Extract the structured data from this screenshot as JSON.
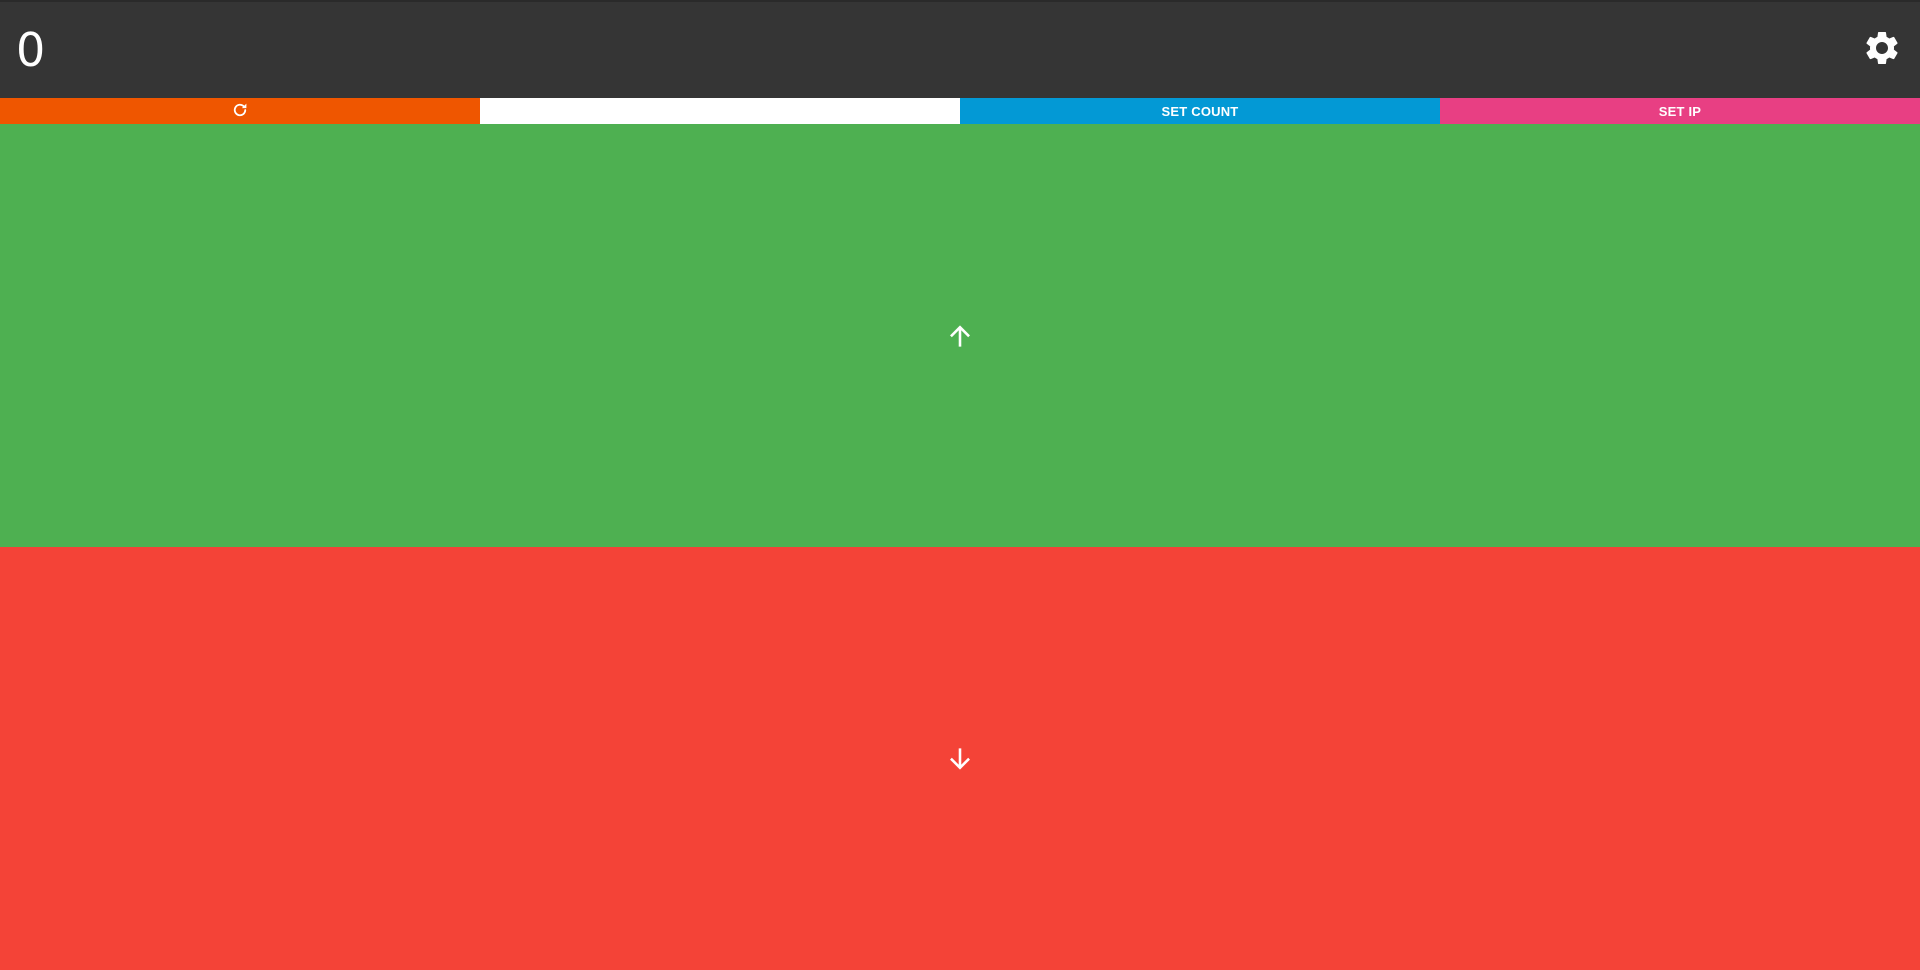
{
  "header": {
    "count_value": "0",
    "settings_icon": "gear-icon"
  },
  "toolbar": {
    "reset_icon": "refresh-icon",
    "count_input_value": "",
    "count_input_placeholder": "",
    "set_count_label": "SET COUNT",
    "set_ip_label": "SET IP"
  },
  "pads": {
    "up_icon": "arrow-up-icon",
    "down_icon": "arrow-down-icon"
  },
  "colors": {
    "header_bg": "#353535",
    "reset": "#ef5600",
    "set_count": "#0399d5",
    "set_ip": "#e83f83",
    "up": "#4eb051",
    "down": "#f44337"
  }
}
